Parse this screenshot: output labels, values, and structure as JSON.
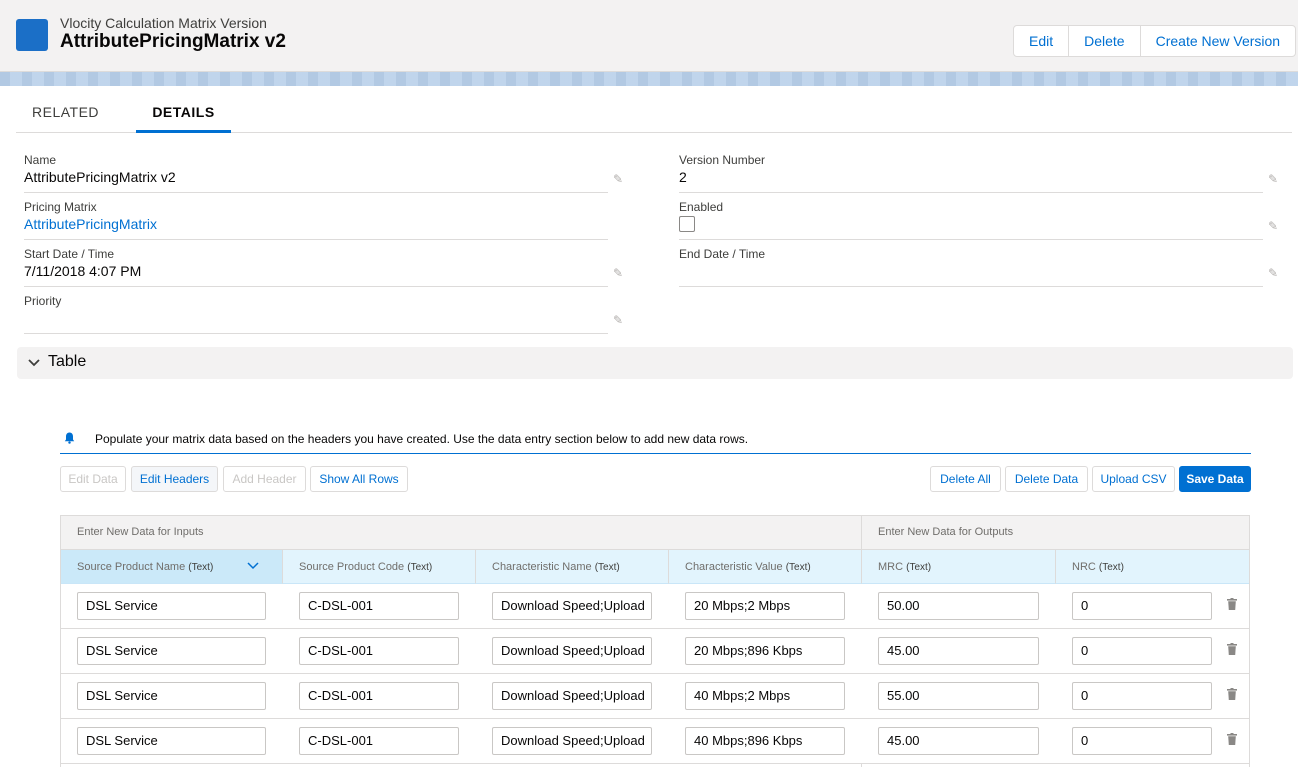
{
  "header": {
    "object_type": "Vlocity Calculation Matrix Version",
    "record_name": "AttributePricingMatrix v2",
    "actions": [
      "Edit",
      "Delete",
      "Create New Version"
    ]
  },
  "tabs": [
    {
      "label": "RELATED",
      "active": false
    },
    {
      "label": "DETAILS",
      "active": true
    }
  ],
  "details": {
    "name": {
      "label": "Name",
      "value": "AttributePricingMatrix v2"
    },
    "version_number": {
      "label": "Version Number",
      "value": "2"
    },
    "pricing_matrix": {
      "label": "Pricing Matrix",
      "value": "AttributePricingMatrix"
    },
    "enabled": {
      "label": "Enabled",
      "checked": false
    },
    "start_date": {
      "label": "Start Date / Time",
      "value": "7/11/2018 4:07 PM"
    },
    "end_date": {
      "label": "End Date / Time",
      "value": ""
    },
    "priority": {
      "label": "Priority",
      "value": ""
    }
  },
  "section": {
    "title": "Table",
    "expanded": true
  },
  "info_banner": {
    "message": "Populate your matrix data based on the headers you have created. Use the data entry section below to add new data rows.",
    "icon": "bell-icon"
  },
  "toolbar": {
    "edit_data": "Edit Data",
    "edit_headers": "Edit Headers",
    "add_header": "Add Header",
    "show_all_rows": "Show All Rows",
    "delete_all": "Delete All",
    "delete_data": "Delete Data",
    "upload_csv": "Upload CSV",
    "save_data": "Save Data"
  },
  "matrix": {
    "input_group_label": "Enter New Data for Inputs",
    "output_group_label": "Enter New Data for Outputs",
    "columns": [
      {
        "name": "Source Product Name",
        "type": "(Text)"
      },
      {
        "name": "Source Product Code",
        "type": "(Text)"
      },
      {
        "name": "Characteristic Name",
        "type": "(Text)"
      },
      {
        "name": "Characteristic Value",
        "type": "(Text)"
      },
      {
        "name": "MRC",
        "type": "(Text)"
      },
      {
        "name": "NRC",
        "type": "(Text)"
      }
    ],
    "rows": [
      [
        "DSL Service",
        "C-DSL-001",
        "Download Speed;Upload",
        "20 Mbps;2 Mbps",
        "50.00",
        "0"
      ],
      [
        "DSL Service",
        "C-DSL-001",
        "Download Speed;Upload",
        "20 Mbps;896 Kbps",
        "45.00",
        "0"
      ],
      [
        "DSL Service",
        "C-DSL-001",
        "Download Speed;Upload",
        "40 Mbps;2 Mbps",
        "55.00",
        "0"
      ],
      [
        "DSL Service",
        "C-DSL-001",
        "Download Speed;Upload",
        "40 Mbps;896 Kbps",
        "45.00",
        "0"
      ]
    ]
  },
  "colors": {
    "brand": "#0070d2",
    "header_bg": "#f3f2f2",
    "column_header_bg": "#e2f4fd"
  }
}
